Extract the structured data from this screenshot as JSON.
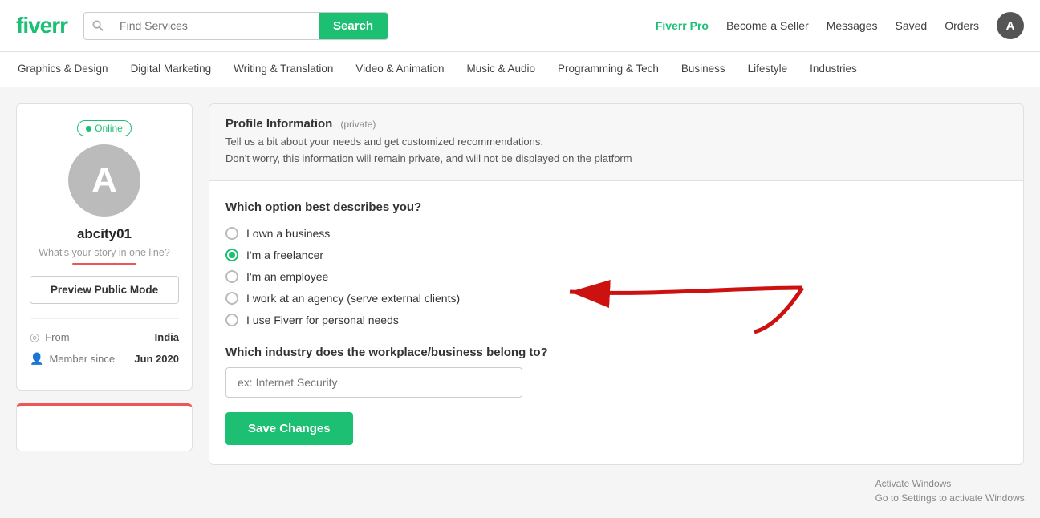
{
  "header": {
    "logo": "fiverr",
    "search_placeholder": "Find Services",
    "search_button": "Search",
    "nav": {
      "pro": "Fiverr Pro",
      "become_seller": "Become a Seller",
      "messages": "Messages",
      "saved": "Saved",
      "orders": "Orders",
      "avatar_letter": "A"
    }
  },
  "categories": [
    "Graphics & Design",
    "Digital Marketing",
    "Writing & Translation",
    "Video & Animation",
    "Music & Audio",
    "Programming & Tech",
    "Business",
    "Lifestyle",
    "Industries"
  ],
  "profile": {
    "online_label": "• Online",
    "avatar_letter": "A",
    "username": "abcity01",
    "tagline": "What's your story in one line?",
    "preview_button": "Preview Public Mode",
    "from_label": "From",
    "from_value": "India",
    "member_since_label": "Member since",
    "member_since_value": "Jun 2020"
  },
  "form": {
    "info_title": "Profile Information",
    "private_label": "(private)",
    "info_desc_line1": "Tell us a bit about your needs and get customized recommendations.",
    "info_desc_line2": "Don't worry, this information will remain private, and will not be displayed on the platform",
    "question1": "Which option best describes you?",
    "options": [
      {
        "label": "I own a business",
        "selected": false
      },
      {
        "label": "I'm a freelancer",
        "selected": true
      },
      {
        "label": "I'm an employee",
        "selected": false
      },
      {
        "label": "I work at an agency (serve external clients)",
        "selected": false
      },
      {
        "label": "I use Fiverr for personal needs",
        "selected": false
      }
    ],
    "question2": "Which industry does the workplace/business belong to?",
    "industry_placeholder": "ex: Internet Security",
    "save_button": "Save Changes"
  },
  "windows": {
    "line1": "Activate Windows",
    "line2": "Go to Settings to activate Windows."
  }
}
